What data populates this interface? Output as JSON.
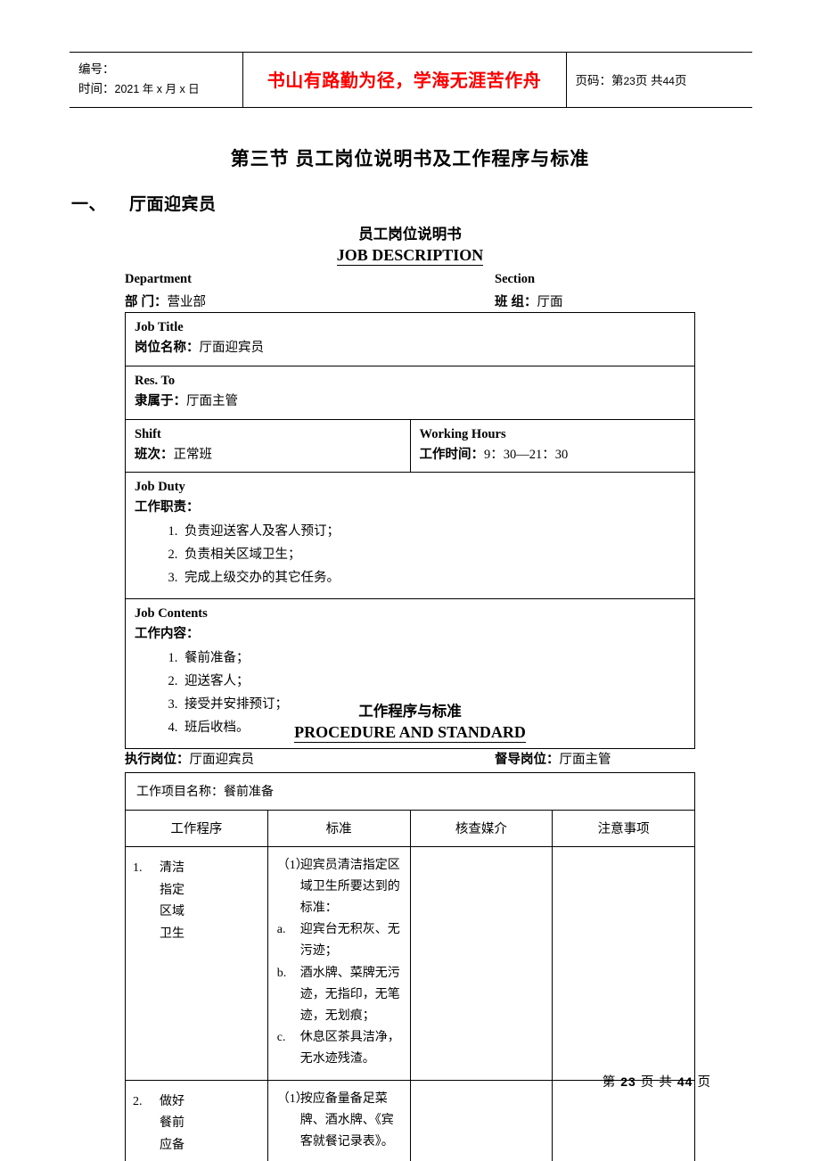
{
  "header": {
    "code_label": "编号：",
    "date_label": "时间：",
    "date_value": "2021 年 x 月 x 日",
    "motto": "书山有路勤为径，学海无涯苦作舟",
    "motto_color": "#FF0000",
    "page_label": "页码：第",
    "page_current": "23",
    "page_mid": "页  共",
    "page_total": "44",
    "page_suffix": "页"
  },
  "section": {
    "title": "第三节   员工岗位说明书及工作程序与标准",
    "subtitle_num": "一、",
    "subtitle_text": "厅面迎宾员"
  },
  "job_description": {
    "title_cn": "员工岗位说明书",
    "title_en": "JOB DESCRIPTION",
    "department_en": "Department",
    "department_cn_label": "部        门：",
    "department_cn_value": "营业部",
    "section_en": "Section",
    "section_cn_label": "班        组：",
    "section_cn_value": "厅面",
    "rows": [
      {
        "en": "Job Title",
        "cn_label": "岗位名称：",
        "cn_value": "厅面迎宾员"
      },
      {
        "en": "Res. To",
        "cn_label": "隶属于：",
        "cn_value": "厅面主管"
      }
    ],
    "shift": {
      "en": "Shift",
      "cn_label": "班次：",
      "cn_value": "正常班"
    },
    "working_hours": {
      "en": "Working Hours",
      "cn_label": "工作时间：",
      "cn_value": "9：30—21：30"
    },
    "job_duty": {
      "en": "Job Duty",
      "cn_label": "工作职责：",
      "items": [
        "负责迎送客人及客人预订；",
        "负责相关区域卫生；",
        "完成上级交办的其它任务。"
      ]
    },
    "job_contents": {
      "en": "Job Contents",
      "cn_label": "工作内容：",
      "items": [
        "餐前准备；",
        "迎送客人；",
        "接受并安排预订；",
        "班后收档。"
      ]
    }
  },
  "procedure_standard": {
    "title_cn": "工作程序与标准",
    "title_en": "PROCEDURE AND STANDARD",
    "exec_label": "执行岗位：",
    "exec_value": "厅面迎宾员",
    "super_label": "督导岗位：",
    "super_value": "厅面主管",
    "project_label": "工作项目名称：",
    "project_value": "餐前准备",
    "columns": [
      "工作程序",
      "标准",
      "核查媒介",
      "注意事项"
    ],
    "rows": [
      {
        "num": "1.",
        "proc_lines": [
          "清洁",
          "指定",
          "区域",
          "卫生"
        ],
        "standard": [
          {
            "mark": "（1）",
            "text": "迎宾员清洁指定区域卫生所要达到的标准："
          },
          {
            "mark": "a.",
            "text": "迎宾台无积灰、无污迹；"
          },
          {
            "mark": "b.",
            "text": "酒水牌、菜牌无污迹，无指印，无笔迹，无划痕；"
          },
          {
            "mark": "c.",
            "text": "休息区茶具洁净，无水迹残渣。"
          }
        ],
        "medium": "",
        "note": ""
      },
      {
        "num": "2.",
        "proc_lines": [
          "做好",
          "餐前",
          "应备"
        ],
        "standard": [
          {
            "mark": "（1）",
            "text": "按应备量备足菜牌、酒水牌、《宾客就餐记录表》。"
          }
        ],
        "medium": "",
        "note": ""
      }
    ]
  },
  "footer": {
    "prefix": "第",
    "current": "23",
    "mid": "页 共",
    "total": "44",
    "suffix": "页"
  }
}
